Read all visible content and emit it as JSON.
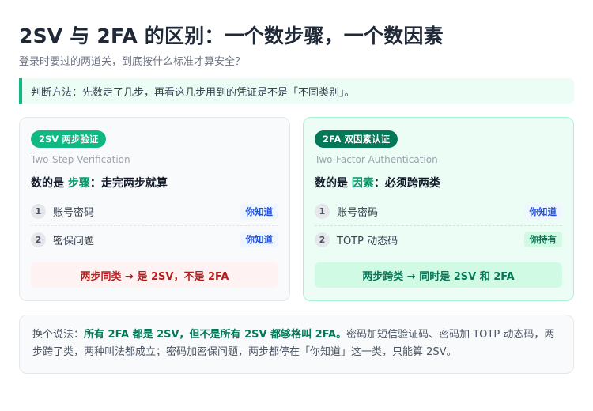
{
  "header": {
    "title": "2SV 与 2FA 的区别：一个数步骤，一个数因素",
    "subtitle": "登录时要过的两道关，到底按什么标准才算安全？"
  },
  "callout": {
    "text": "判断方法：先数走了几步，再看这几步用到的凭证是不是「不同类别」。"
  },
  "cards": {
    "left": {
      "badge": "2SV 两步验证",
      "english": "Two-Step Verification",
      "rule_prefix": "数的是",
      "rule_highlight": "步骤",
      "rule_suffix": "：走完两步就算",
      "rows": [
        {
          "num": "1",
          "label": "账号密码",
          "tag": "你知道"
        },
        {
          "num": "2",
          "label": "密保问题",
          "tag": "你知道"
        }
      ],
      "verdict": "两步同类 → 是 2SV，不是 2FA"
    },
    "right": {
      "badge": "2FA 双因素认证",
      "english": "Two-Factor Authentication",
      "rule_prefix": "数的是",
      "rule_highlight": "因素",
      "rule_suffix": "：必须跨两类",
      "rows": [
        {
          "num": "1",
          "label": "账号密码",
          "tag": "你知道"
        },
        {
          "num": "2",
          "label": "TOTP 动态码",
          "tag": "你持有"
        }
      ],
      "verdict": "两步跨类 → 同时是 2SV 和 2FA"
    }
  },
  "note": {
    "prefix": "换个说法：",
    "emphasis": "所有 2FA 都是 2SV，但不是所有 2SV 都够格叫 2FA。",
    "rest": "密码加短信验证码、密码加 TOTP 动态码，两步跨了类，两种叫法都成立；密码加密保问题，两步都停在「你知道」这一类，只能算 2SV。"
  },
  "colors": {
    "accent": "#10b981",
    "accent_dark": "#047857",
    "warning_bg": "#fef2f2",
    "warning_text": "#b91c1c",
    "tag_blue": "#1d4ed8"
  }
}
